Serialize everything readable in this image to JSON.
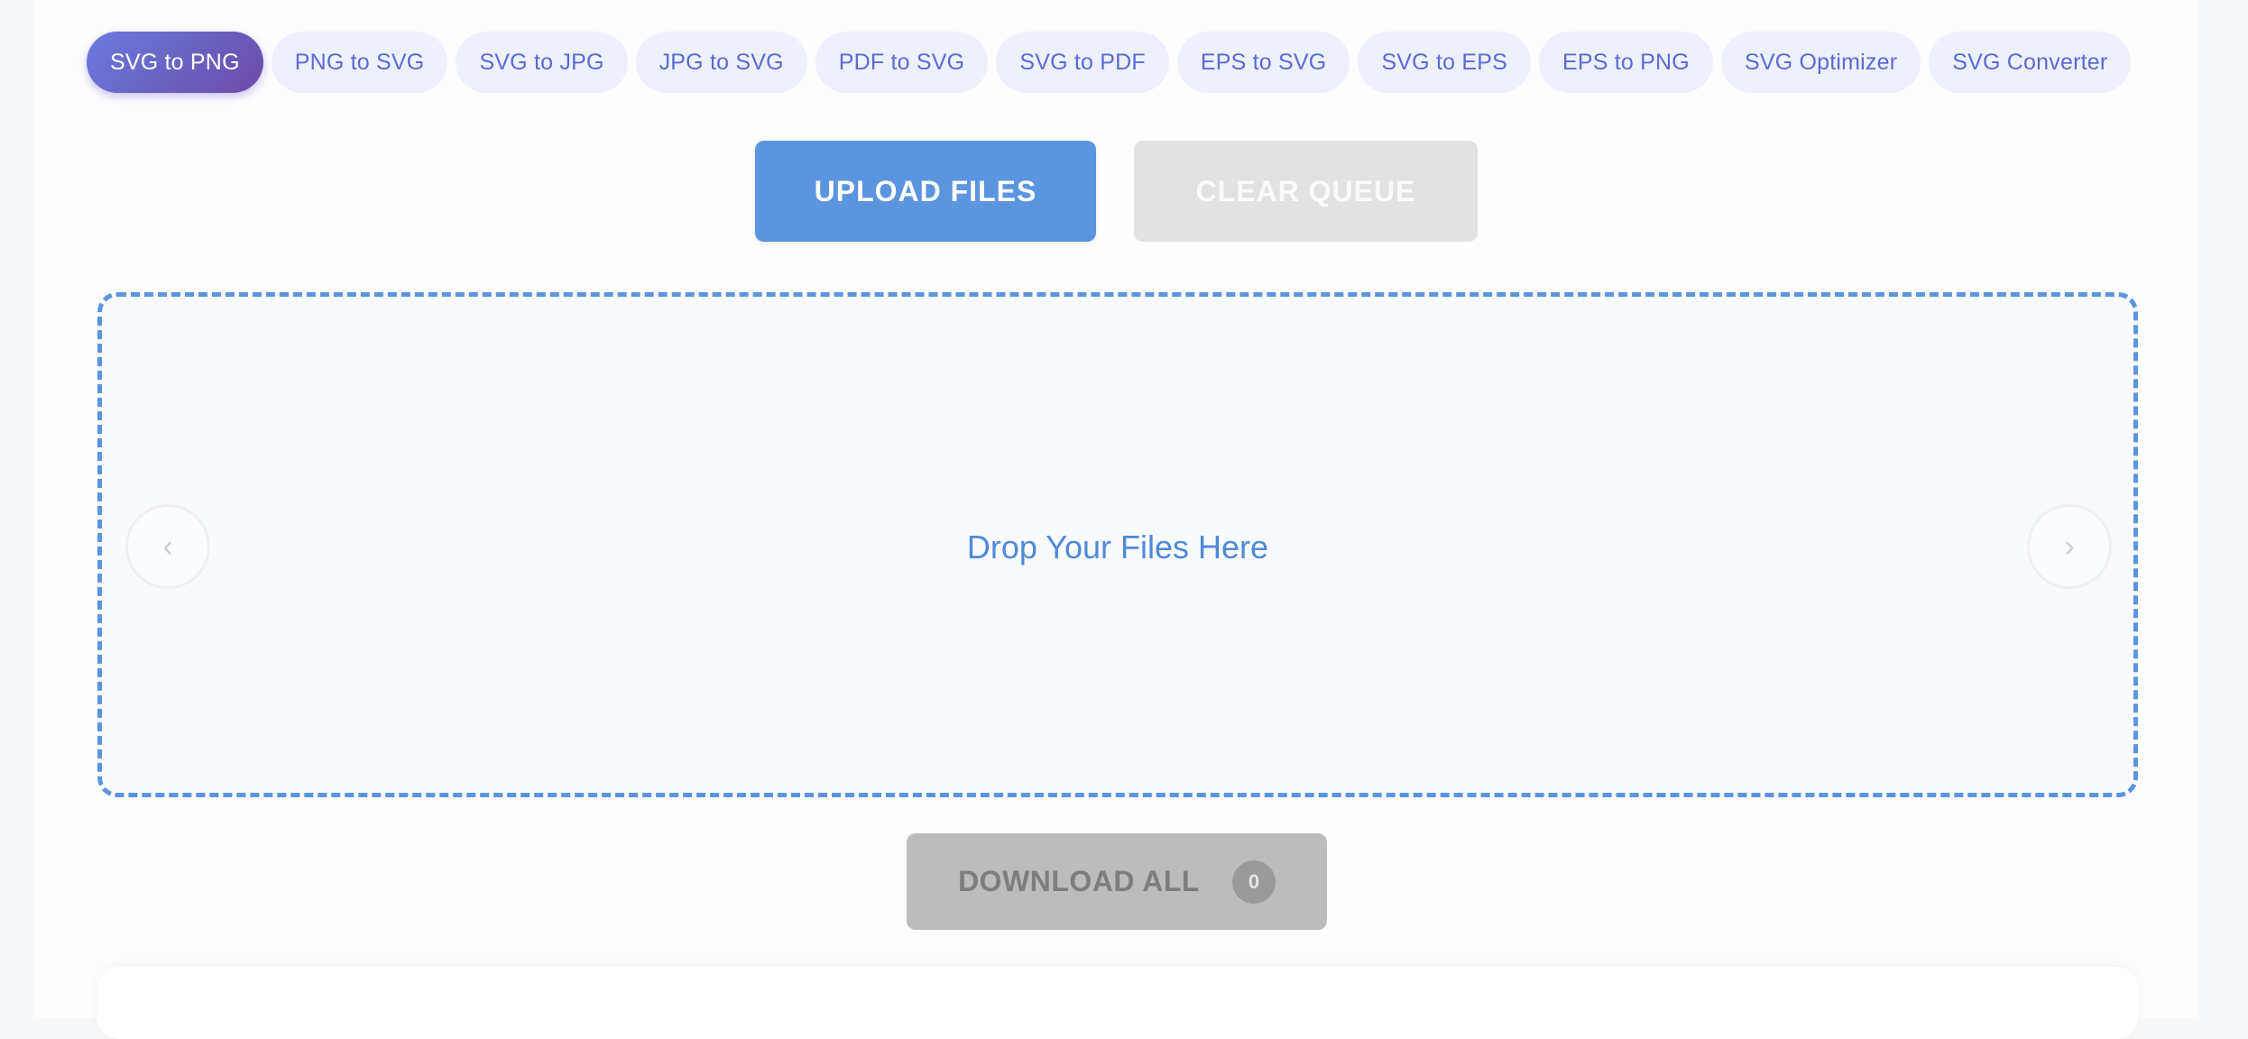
{
  "tabs": [
    {
      "label": "SVG to PNG",
      "active": true
    },
    {
      "label": "PNG to SVG",
      "active": false
    },
    {
      "label": "SVG to JPG",
      "active": false
    },
    {
      "label": "JPG to SVG",
      "active": false
    },
    {
      "label": "PDF to SVG",
      "active": false
    },
    {
      "label": "SVG to PDF",
      "active": false
    },
    {
      "label": "EPS to SVG",
      "active": false
    },
    {
      "label": "SVG to EPS",
      "active": false
    },
    {
      "label": "EPS to PNG",
      "active": false
    },
    {
      "label": "SVG Optimizer",
      "active": false
    },
    {
      "label": "SVG Converter",
      "active": false
    }
  ],
  "actions": {
    "upload_label": "UPLOAD FILES",
    "clear_label": "CLEAR QUEUE"
  },
  "dropzone": {
    "text": "Drop Your Files Here",
    "prev_icon": "chevron-left",
    "next_icon": "chevron-right"
  },
  "download": {
    "label": "DOWNLOAD ALL",
    "count": "0"
  },
  "colors": {
    "accent": "#5b94df",
    "tab_text": "#5a6bd6",
    "tab_bg": "#eef1fb",
    "active_tab_gradient_start": "#6a7ce0",
    "active_tab_gradient_end": "#6b4aa6",
    "disabled_bg": "#e2e2e2",
    "download_bg": "#bcbcbc"
  }
}
